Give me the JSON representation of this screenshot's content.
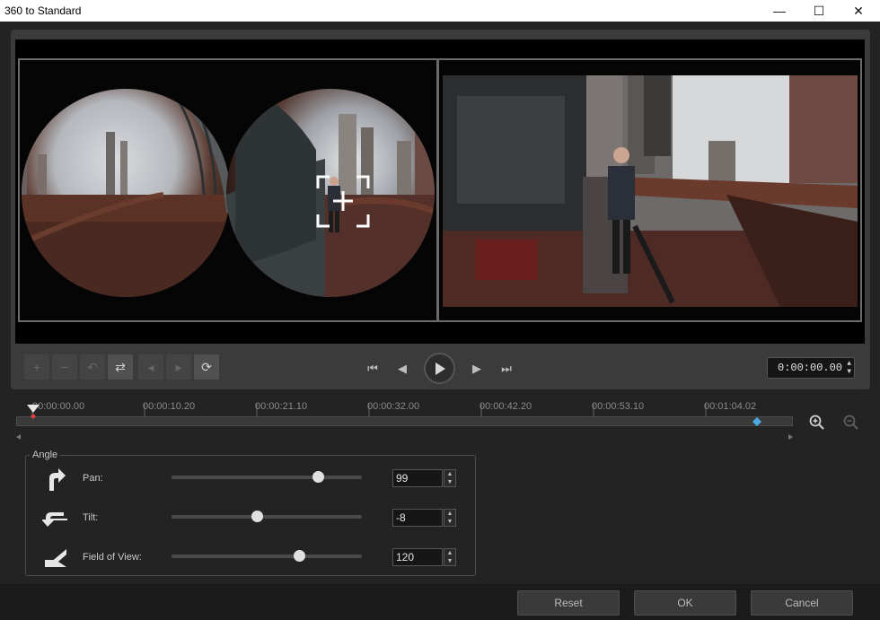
{
  "window": {
    "title": "360 to Standard",
    "minimize_glyph": "—",
    "maximize_glyph": "☐",
    "close_glyph": "✕"
  },
  "toolbar": {
    "edit_buttons": [
      {
        "icon": "add-keyframe-icon",
        "glyph": "+",
        "enabled": false
      },
      {
        "icon": "remove-keyframe-icon",
        "glyph": "−",
        "enabled": false
      },
      {
        "icon": "reverse-keyframe-icon",
        "glyph": "↶",
        "enabled": false
      },
      {
        "icon": "swap-icon",
        "glyph": "⇄",
        "enabled": true
      },
      {
        "icon": "previous-keyframe-icon",
        "glyph": "◂",
        "enabled": false
      },
      {
        "icon": "next-keyframe-icon",
        "glyph": "▸",
        "enabled": false
      },
      {
        "icon": "reset-keyframe-icon",
        "glyph": "⟳",
        "enabled": true
      }
    ]
  },
  "playback": {
    "home_glyph": "⏮",
    "prev_frame_glyph": "◀",
    "next_frame_glyph": "▶",
    "end_glyph": "⏭",
    "timecode": "0:00:00.00",
    "spin_up": "▲",
    "spin_down": "▼"
  },
  "timeline": {
    "ticks": [
      "00:00:00.00",
      "00:00:10.20",
      "00:00:21.10",
      "00:00:32.00",
      "00:00:42.20",
      "00:00:53.10",
      "00:01:04.02"
    ],
    "playhead_fraction": 0.014,
    "keyframe_fraction": 0.955,
    "zoom_in_icon": "zoom-in-icon",
    "zoom_out_icon": "zoom-out-icon"
  },
  "angle": {
    "title": "Angle",
    "rows": [
      {
        "label": "Pan:",
        "value": "99",
        "slider_fraction": 0.77,
        "icon": "pan-icon"
      },
      {
        "label": "Tilt:",
        "value": "-8",
        "slider_fraction": 0.45,
        "icon": "tilt-icon"
      },
      {
        "label": "Field of View:",
        "value": "120",
        "slider_fraction": 0.67,
        "icon": "field-of-view-icon"
      }
    ]
  },
  "footer": {
    "reset_label": "Reset",
    "ok_label": "OK",
    "cancel_label": "Cancel"
  },
  "colors": {
    "panel": "#3b3b3b",
    "background": "#232323",
    "keyframe_marker": "#4aa9e0",
    "playhead_marker": "#e04040"
  }
}
